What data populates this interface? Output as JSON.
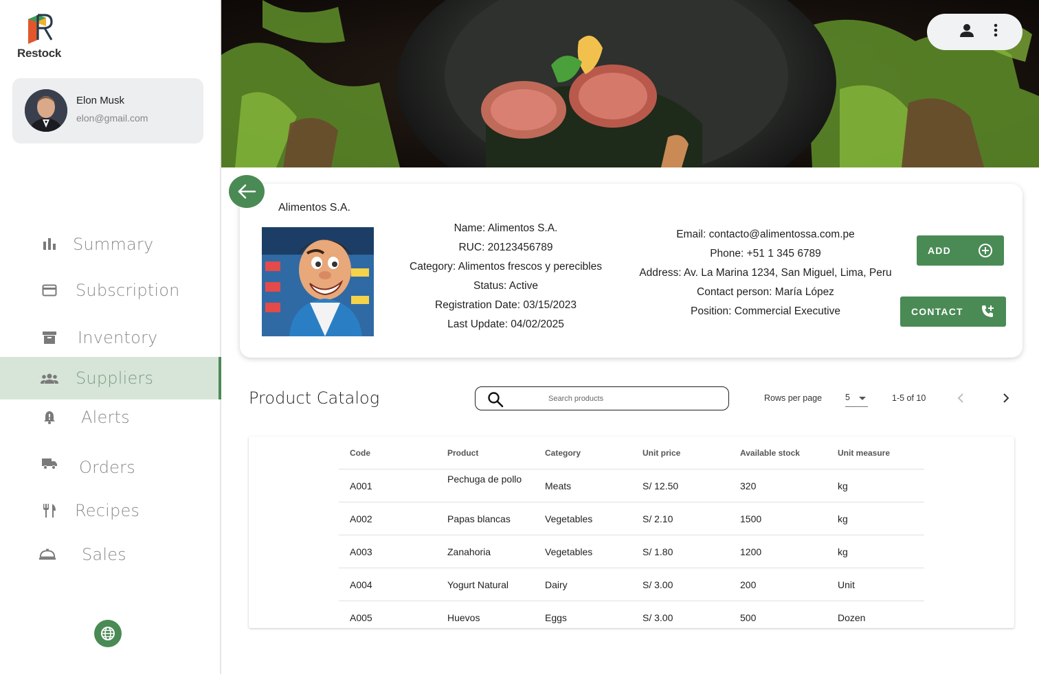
{
  "app": {
    "name": "Restock"
  },
  "user": {
    "name": "Elon Musk",
    "email": "elon@gmail.com"
  },
  "nav": {
    "items": [
      {
        "label": "Summary",
        "icon": "bar-chart-icon"
      },
      {
        "label": "Subscription",
        "icon": "credit-card-icon"
      },
      {
        "label": "Inventory",
        "icon": "archive-box-icon"
      },
      {
        "label": "Suppliers",
        "icon": "group-icon",
        "active": true
      },
      {
        "label": "Alerts",
        "icon": "bell-icon"
      },
      {
        "label": "Orders",
        "icon": "truck-icon"
      },
      {
        "label": "Recipes",
        "icon": "utensils-icon"
      },
      {
        "label": "Sales",
        "icon": "service-bell-icon"
      }
    ]
  },
  "supplier": {
    "title": "Alimentos S.A.",
    "details": [
      "Name: Alimentos S.A.",
      "RUC: 20123456789",
      "Category: Alimentos frescos y perecibles",
      "Status: Active",
      "Registration Date: 03/15/2023",
      "Last Update: 04/02/2025"
    ],
    "contact": [
      "Email: contacto@alimentossa.com.pe",
      "Phone: +51 1 345 6789",
      "Address: Av. La Marina 1234, San Miguel, Lima, Peru",
      "Contact person: María López",
      "Position: Commercial Executive"
    ],
    "add_label": "ADD",
    "contact_label": "CONTACT"
  },
  "catalog": {
    "title": "Product Catalog",
    "search_placeholder": "Search products",
    "rows_per_page_label": "Rows per page",
    "rows_per_page": "5",
    "page_range": "1-5 of 10",
    "columns": [
      "Code",
      "Product",
      "Category",
      "Unit price",
      "Available stock",
      "Unit measure"
    ],
    "rows": [
      [
        "A001",
        "Pechuga de pollo",
        "Meats",
        "S/ 12.50",
        "320",
        "kg"
      ],
      [
        "A002",
        "Papas blancas",
        "Vegetables",
        "S/ 2.10",
        "1500",
        "kg"
      ],
      [
        "A003",
        "Zanahoria",
        "Vegetables",
        "S/ 1.80",
        "1200",
        "kg"
      ],
      [
        "A004",
        "Yogurt Natural",
        "Dairy",
        "S/ 3.00",
        "200",
        "Unit"
      ],
      [
        "A005",
        "Huevos",
        "Eggs",
        "S/ 3.00",
        "500",
        "Dozen"
      ]
    ]
  },
  "colors": {
    "accent": "#4a8a55",
    "active_nav_bg": "#d7e5d8"
  }
}
